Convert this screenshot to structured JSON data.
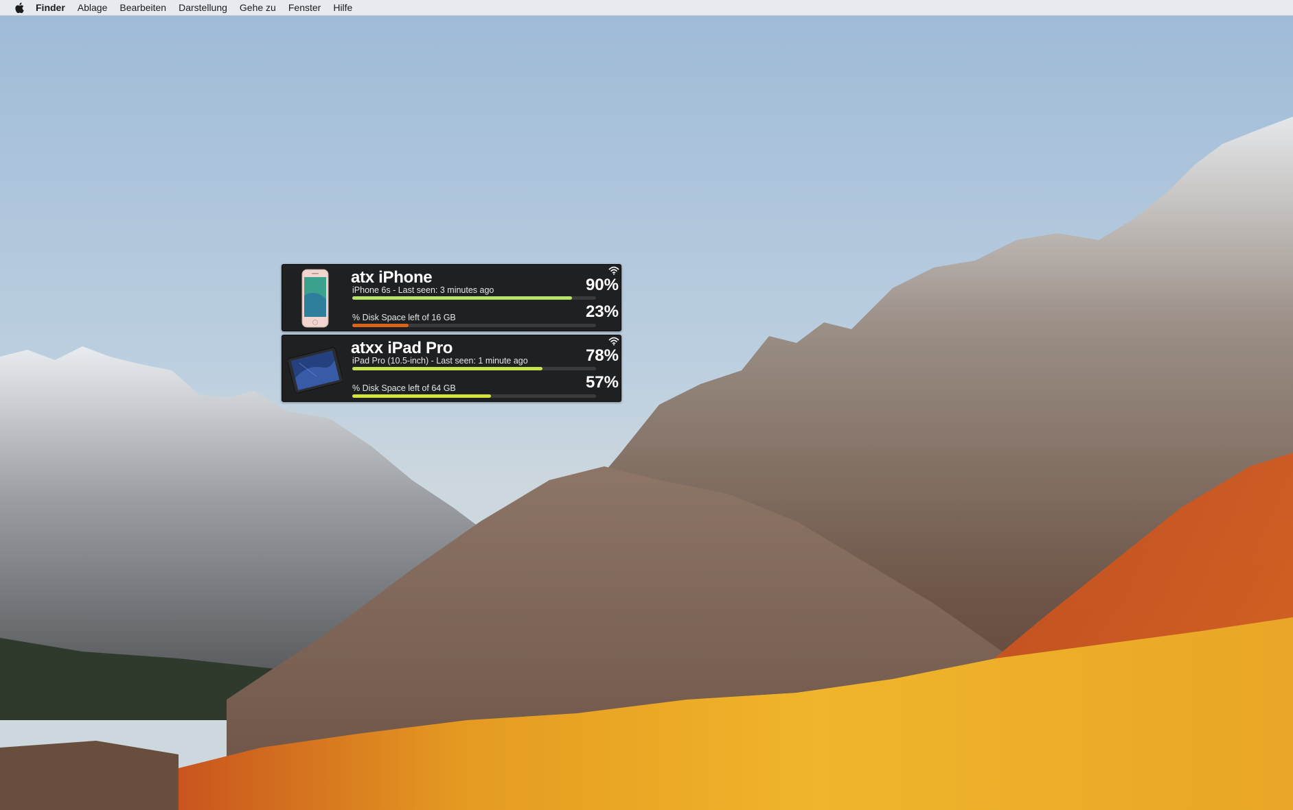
{
  "menubar": {
    "apple_icon": "apple-logo-icon",
    "items": [
      {
        "label": "Finder",
        "app": true
      },
      {
        "label": "Ablage"
      },
      {
        "label": "Bearbeiten"
      },
      {
        "label": "Darstellung"
      },
      {
        "label": "Gehe zu"
      },
      {
        "label": "Fenster"
      },
      {
        "label": "Hilfe"
      }
    ]
  },
  "devices": [
    {
      "name": "atx iPhone",
      "subtitle": "iPhone 6s - Last seen: 3 minutes ago",
      "battery_pct_label": "90%",
      "battery_fraction": 0.9,
      "battery_color": "#b7e36a",
      "disk_label": "% Disk Space left of 16 GB",
      "disk_pct_label": "23%",
      "disk_fraction": 0.23,
      "disk_color": "#d9651a",
      "icon": "iphone-image-icon",
      "connection_icon": "wifi-icon"
    },
    {
      "name": "atxx iPad Pro",
      "subtitle": "iPad Pro (10.5-inch) - Last seen: 1 minute ago",
      "battery_pct_label": "78%",
      "battery_fraction": 0.78,
      "battery_color": "#c4e34f",
      "disk_label": "% Disk Space left of 64 GB",
      "disk_pct_label": "57%",
      "disk_fraction": 0.57,
      "disk_color": "#d6e33a",
      "icon": "ipad-image-icon",
      "connection_icon": "wifi-icon"
    }
  ]
}
